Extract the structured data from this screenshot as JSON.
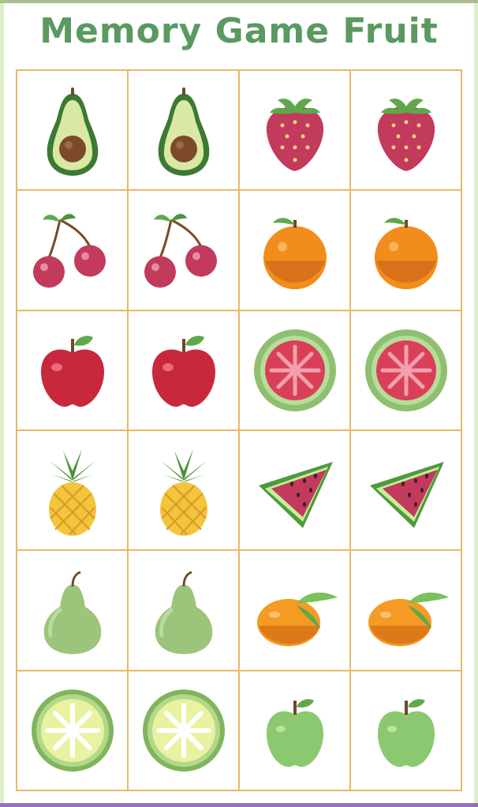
{
  "title": "Memory Game Fruit",
  "colors": {
    "title": "#5a9960",
    "grid_line": "#e8b868"
  },
  "cards": [
    "avocado-icon",
    "avocado-icon",
    "strawberry-icon",
    "strawberry-icon",
    "cherry-icon",
    "cherry-icon",
    "orange-icon",
    "orange-icon",
    "apple-icon",
    "apple-icon",
    "guava-icon",
    "guava-icon",
    "pineapple-icon",
    "pineapple-icon",
    "watermelon-icon",
    "watermelon-icon",
    "pear-icon",
    "pear-icon",
    "tangerine-icon",
    "tangerine-icon",
    "lime-slice-icon",
    "lime-slice-icon",
    "green-apple-icon",
    "green-apple-icon"
  ]
}
